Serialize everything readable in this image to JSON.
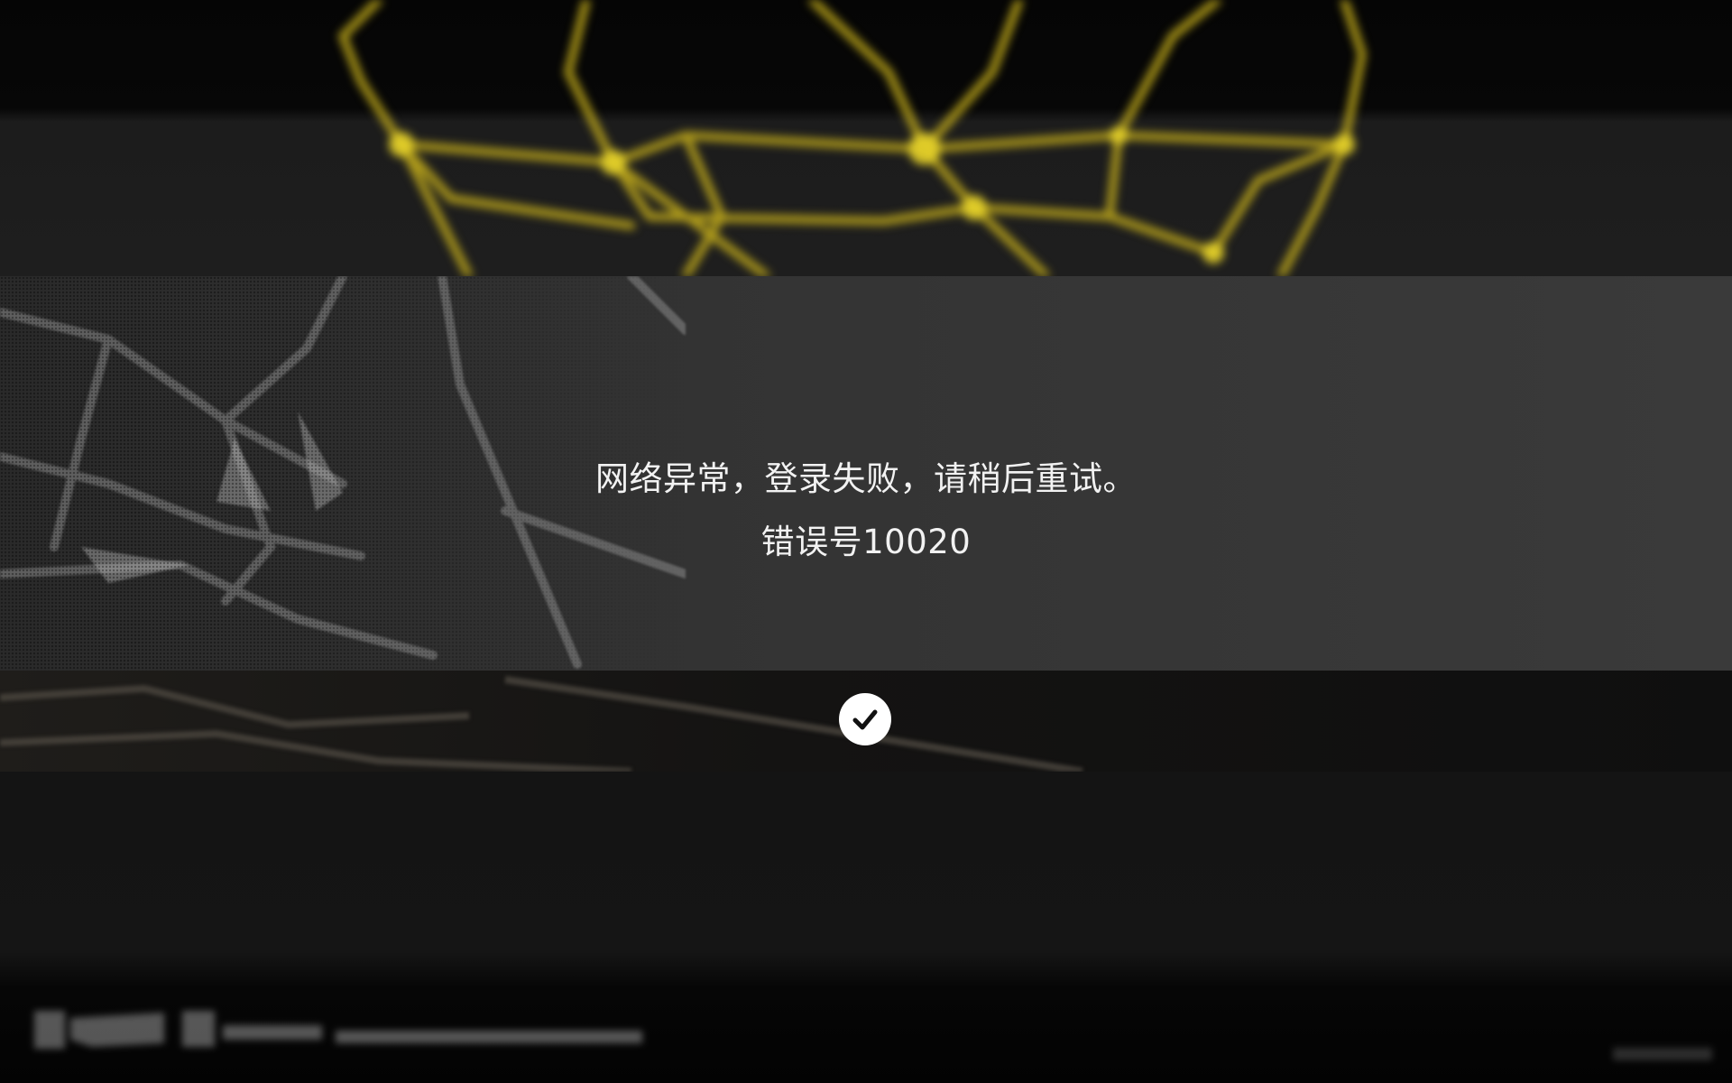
{
  "dialog": {
    "message_line1": "网络异常，登录失败，请稍后重试。",
    "message_line2": "错误号10020"
  },
  "confirm": {
    "icon": "checkmark-icon"
  },
  "colors": {
    "wireframe": "#d8c21a",
    "band": "#363636",
    "button": "#ffffff"
  }
}
